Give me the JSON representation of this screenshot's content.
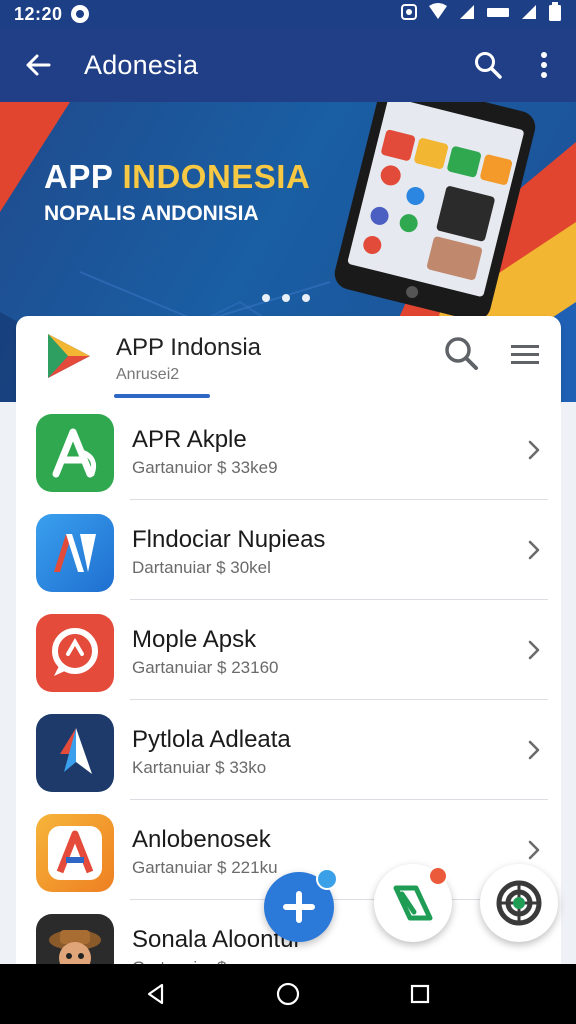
{
  "status_bar": {
    "time": "12:20"
  },
  "toolbar": {
    "title": "Adonesia"
  },
  "banner": {
    "headline_part1": "APP ",
    "headline_part2": "INDONESIA",
    "subline": "NOPALIS ANDONISIA",
    "dot_count": 3
  },
  "app_header": {
    "name": "APP Indonsia",
    "subtitle": "Anrusei2"
  },
  "apps": [
    {
      "name": "APR Akple",
      "meta": "Gartanuior $ 33ke9",
      "icon": "letter-a-green-icon",
      "color": "#2fa84f"
    },
    {
      "name": "Flndociar Nupieas",
      "meta": "Dartanuiar $ 30kel",
      "icon": "letter-n-blue-icon",
      "color": "#2a86e0"
    },
    {
      "name": "Mople Apsk",
      "meta": "Gartanuiar $ 23160",
      "icon": "chat-bubble-icon",
      "color": "#e44b3a"
    },
    {
      "name": "Pytlola Adleata",
      "meta": "Kartanuiar $ 33ko",
      "icon": "arrow-navigation-icon",
      "color": "#1d3a6a"
    },
    {
      "name": "Anlobenosek",
      "meta": "Gartanuiar $ 221ku",
      "icon": "letter-a-orange-icon",
      "color": "#f39a2a"
    },
    {
      "name": "Sonala Aloontur",
      "meta": "Gartanuiar $",
      "icon": "character-avatar-icon",
      "color": "#2b2b2b"
    }
  ],
  "colors": {
    "primary": "#213f86",
    "accent": "#2f67c7",
    "banner_yellow": "#f6c844",
    "banner_red": "#e2452f"
  }
}
